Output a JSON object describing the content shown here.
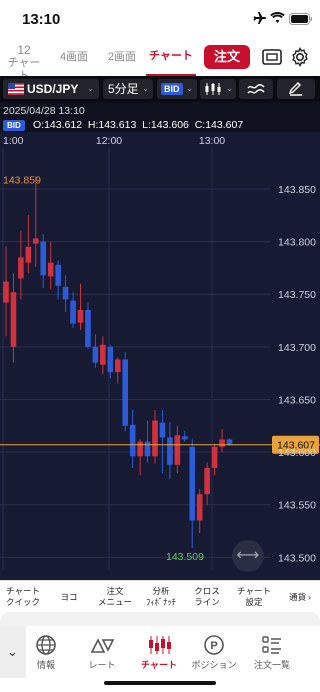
{
  "status": {
    "time": "13:10"
  },
  "tabs": [
    {
      "line1": "12",
      "line2": "チャート"
    },
    {
      "label": "4画面"
    },
    {
      "label": "2画面"
    },
    {
      "label": "チャート"
    }
  ],
  "order_label": "注文",
  "toolbar": {
    "pair": "USD/JPY",
    "interval": "5分足",
    "price_type": "BID"
  },
  "ohlc": {
    "datetime": "2025/04/28 13:10",
    "badge": "BID",
    "text": "O:143.612  H:143.613  L:143.606  C:143.607"
  },
  "chart": {
    "time_labels": [
      "1:00",
      "12:00",
      "13:00"
    ],
    "price_labels": [
      "143.850",
      "143.800",
      "143.750",
      "143.700",
      "143.650",
      "143.600",
      "143.550",
      "143.500"
    ],
    "high_label": "143.859",
    "low_label": "143.509",
    "current_price": "143.607",
    "colors": {
      "up": "#d1313d",
      "down": "#2d5bd6",
      "current": "#e8a33c",
      "bg": "#161a33"
    }
  },
  "chart_data": {
    "type": "candlestick",
    "ylim": [
      143.48,
      143.87
    ],
    "candles": [
      {
        "o": 143.742,
        "h": 143.795,
        "l": 143.71,
        "c": 143.762
      },
      {
        "o": 143.7,
        "h": 143.77,
        "l": 143.685,
        "c": 143.752
      },
      {
        "o": 143.765,
        "h": 143.81,
        "l": 143.745,
        "c": 143.785
      },
      {
        "o": 143.78,
        "h": 143.825,
        "l": 143.77,
        "c": 143.795
      },
      {
        "o": 143.798,
        "h": 143.862,
        "l": 143.776,
        "c": 143.803
      },
      {
        "o": 143.8,
        "h": 143.807,
        "l": 143.756,
        "c": 143.768
      },
      {
        "o": 143.767,
        "h": 143.8,
        "l": 143.755,
        "c": 143.78
      },
      {
        "o": 143.778,
        "h": 143.782,
        "l": 143.745,
        "c": 143.758
      },
      {
        "o": 143.757,
        "h": 143.768,
        "l": 143.733,
        "c": 143.745
      },
      {
        "o": 143.744,
        "h": 143.752,
        "l": 143.718,
        "c": 143.722
      },
      {
        "o": 143.723,
        "h": 143.76,
        "l": 143.716,
        "c": 143.735
      },
      {
        "o": 143.735,
        "h": 143.742,
        "l": 143.698,
        "c": 143.7
      },
      {
        "o": 143.7,
        "h": 143.712,
        "l": 143.68,
        "c": 143.685
      },
      {
        "o": 143.683,
        "h": 143.71,
        "l": 143.674,
        "c": 143.702
      },
      {
        "o": 143.7,
        "h": 143.702,
        "l": 143.67,
        "c": 143.676
      },
      {
        "o": 143.676,
        "h": 143.69,
        "l": 143.665,
        "c": 143.688
      },
      {
        "o": 143.688,
        "h": 143.695,
        "l": 143.62,
        "c": 143.625
      },
      {
        "o": 143.626,
        "h": 143.64,
        "l": 143.585,
        "c": 143.596
      },
      {
        "o": 143.596,
        "h": 143.612,
        "l": 143.578,
        "c": 143.61
      },
      {
        "o": 143.61,
        "h": 143.63,
        "l": 143.59,
        "c": 143.596
      },
      {
        "o": 143.596,
        "h": 143.64,
        "l": 143.589,
        "c": 143.63
      },
      {
        "o": 143.628,
        "h": 143.64,
        "l": 143.58,
        "c": 143.614
      },
      {
        "o": 143.614,
        "h": 143.628,
        "l": 143.574,
        "c": 143.588
      },
      {
        "o": 143.588,
        "h": 143.625,
        "l": 143.58,
        "c": 143.616
      },
      {
        "o": 143.615,
        "h": 143.62,
        "l": 143.61,
        "c": 143.612
      },
      {
        "o": 143.605,
        "h": 143.612,
        "l": 143.509,
        "c": 143.535
      },
      {
        "o": 143.535,
        "h": 143.565,
        "l": 143.523,
        "c": 143.56
      },
      {
        "o": 143.56,
        "h": 143.59,
        "l": 143.55,
        "c": 143.585
      },
      {
        "o": 143.585,
        "h": 143.608,
        "l": 143.578,
        "c": 143.605
      },
      {
        "o": 143.605,
        "h": 143.622,
        "l": 143.6,
        "c": 143.612
      },
      {
        "o": 143.612,
        "h": 143.613,
        "l": 143.606,
        "c": 143.607
      }
    ]
  },
  "bottom_nav": [
    {
      "label": "チャート\nクイック"
    },
    {
      "label": "ヨコ"
    },
    {
      "label": "注文\nメニュー"
    },
    {
      "label": "分析\nﾌｨﾎﾞﾅｯﾁ"
    },
    {
      "label": "クロス\nライン"
    },
    {
      "label": "チャート\n設定"
    },
    {
      "label": "通貨"
    }
  ],
  "tabbar": [
    {
      "label": "情報",
      "icon": "globe-icon"
    },
    {
      "label": "レート",
      "icon": "rate-icon"
    },
    {
      "label": "チャート",
      "icon": "candle-chart-icon"
    },
    {
      "label": "ポジション",
      "icon": "position-icon"
    },
    {
      "label": "注文一覧",
      "icon": "list-icon"
    }
  ]
}
